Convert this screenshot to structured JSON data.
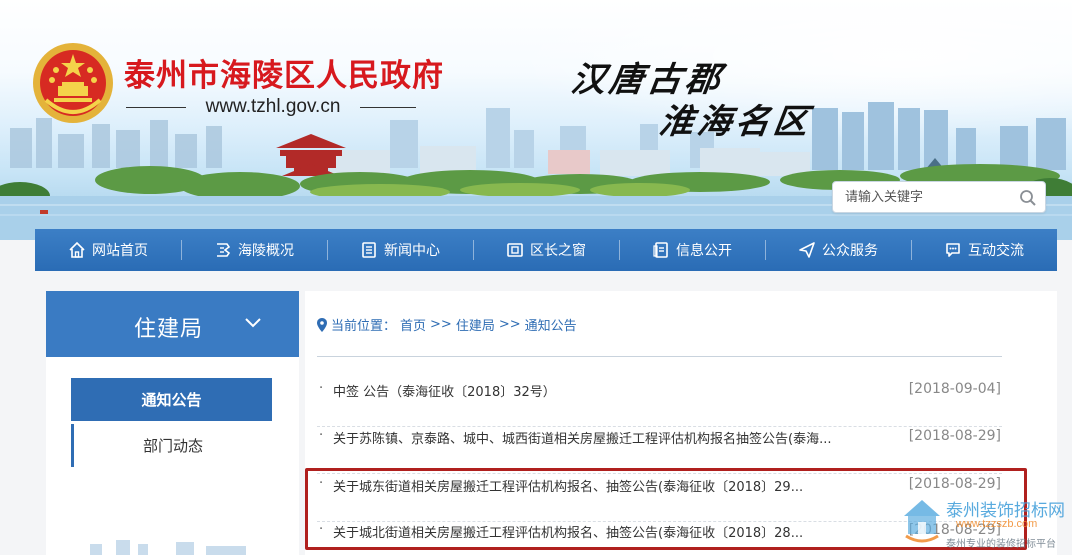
{
  "header": {
    "site_title": "泰州市海陵区人民政府",
    "site_url": "www.tzhl.gov.cn",
    "slogan_line1": "汉唐古郡",
    "slogan_line2": "淮海名区",
    "brand_color": "#d7191e"
  },
  "search": {
    "placeholder": "请输入关键字",
    "icon": "search-icon"
  },
  "nav": {
    "color": "#2a6cb5",
    "items": [
      {
        "label": "网站首页",
        "icon": "home-icon"
      },
      {
        "label": "海陵概况",
        "icon": "overview-icon"
      },
      {
        "label": "新闻中心",
        "icon": "news-icon"
      },
      {
        "label": "区长之窗",
        "icon": "window-icon"
      },
      {
        "label": "信息公开",
        "icon": "document-icon"
      },
      {
        "label": "公众服务",
        "icon": "send-icon"
      },
      {
        "label": "互动交流",
        "icon": "chat-icon"
      }
    ]
  },
  "sidebar": {
    "title": "住建局",
    "items": [
      {
        "label": "通知公告",
        "active": true
      },
      {
        "label": "部门动态",
        "active": false
      }
    ]
  },
  "breadcrumb": {
    "prefix": "当前位置：",
    "home": "首页",
    "sep1": ">>",
    "level1": "住建局",
    "sep2": ">>",
    "level2": "通知公告"
  },
  "news": {
    "dot": "·",
    "items": [
      {
        "title": "中签 公告（泰海征收〔2018〕32号）",
        "date": "[2018-09-04]"
      },
      {
        "title": "关于苏陈镇、京泰路、城中、城西街道相关房屋搬迁工程评估机构报名抽签公告(泰海...",
        "date": "[2018-08-29]"
      },
      {
        "title": "关于城东街道相关房屋搬迁工程评估机构报名、抽签公告(泰海征收〔2018〕29...",
        "date": "[2018-08-29]"
      },
      {
        "title": "关于城北街道相关房屋搬迁工程评估机构报名、抽签公告(泰海征收〔2018〕28...",
        "date": "[2018-08-29]"
      }
    ]
  },
  "highlight_color": "#b0201e",
  "watermark": {
    "title": "泰州装饰招标网",
    "url": "www.tzzszb.com",
    "subtitle": "泰州专业的装修招标平台"
  }
}
